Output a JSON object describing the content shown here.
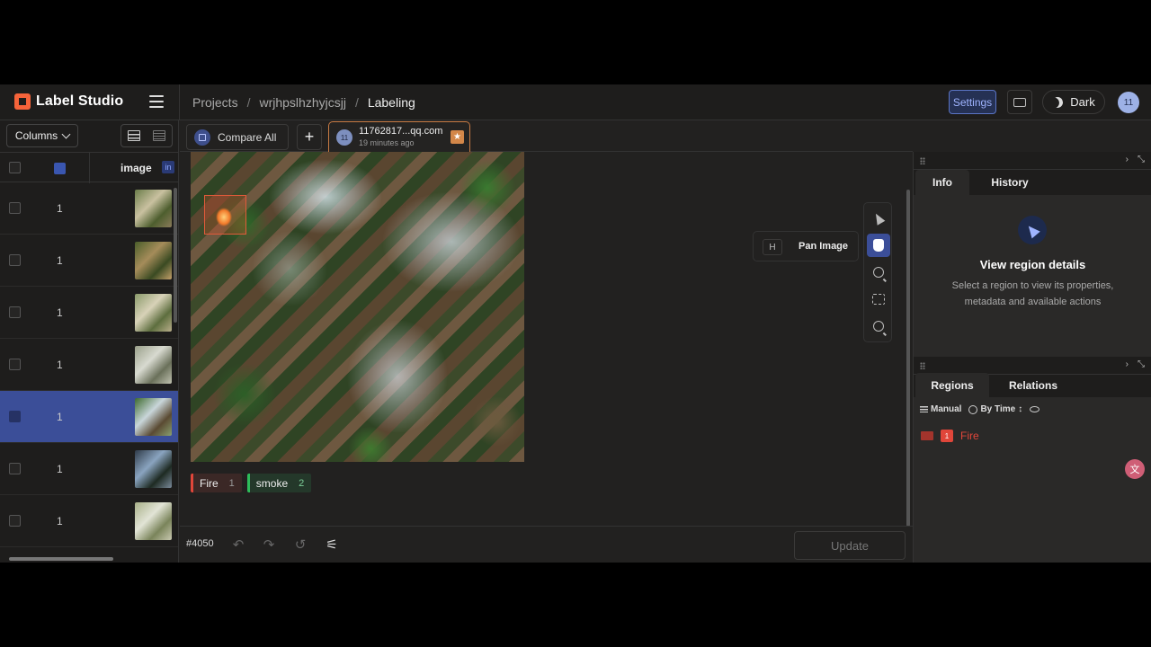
{
  "app": {
    "name": "Label Studio"
  },
  "breadcrumb": {
    "projects": "Projects",
    "sep1": "/",
    "project": "wrjhpslhzhyjcsjj",
    "sep2": "/",
    "current": "Labeling"
  },
  "header": {
    "settings_label": "Settings",
    "theme_label": "Dark",
    "user_initials": "11"
  },
  "left": {
    "columns_label": "Columns",
    "table": {
      "header_image": "image",
      "header_badge": "in",
      "rows": [
        {
          "value": "1",
          "selected": false
        },
        {
          "value": "1",
          "selected": false
        },
        {
          "value": "1",
          "selected": false
        },
        {
          "value": "1",
          "selected": false
        },
        {
          "value": "1",
          "selected": true
        },
        {
          "value": "1",
          "selected": false
        },
        {
          "value": "1",
          "selected": false
        }
      ]
    }
  },
  "tabs": {
    "compare_label": "Compare All",
    "add_label": "+",
    "annotation": {
      "initials": "11",
      "user": "11762817...qq.com",
      "time": "19 minutes ago",
      "star": "★"
    }
  },
  "canvas": {
    "tooltip_key": "H",
    "tooltip_text": "Pan Image",
    "tools": [
      "pointer-icon",
      "hand-icon",
      "zoom-in-icon",
      "fit-icon",
      "zoom-out-icon"
    ],
    "active_tool": "hand-icon",
    "labels": [
      {
        "name": "Fire",
        "hotkey": "1",
        "color": "#e0463a"
      },
      {
        "name": "smoke",
        "hotkey": "2",
        "color": "#2dbc5a"
      }
    ]
  },
  "bottom": {
    "task_id": "#4050",
    "update_label": "Update"
  },
  "right": {
    "tabs_top": [
      "Info",
      "History"
    ],
    "info": {
      "title": "View region details",
      "description": "Select a region to view its properties, metadata and available actions"
    },
    "tabs_bottom": [
      "Regions",
      "Relations"
    ],
    "region_tools": {
      "manual": "Manual",
      "sort": "By Time"
    },
    "regions": [
      {
        "index": "1",
        "label": "Fire",
        "color": "#e0463a"
      }
    ],
    "fab_icon": "translate-icon"
  },
  "colors": {
    "accent": "#3b4e98",
    "brand": "#f5633a",
    "fire": "#e0463a",
    "smoke": "#2dbc5a"
  }
}
